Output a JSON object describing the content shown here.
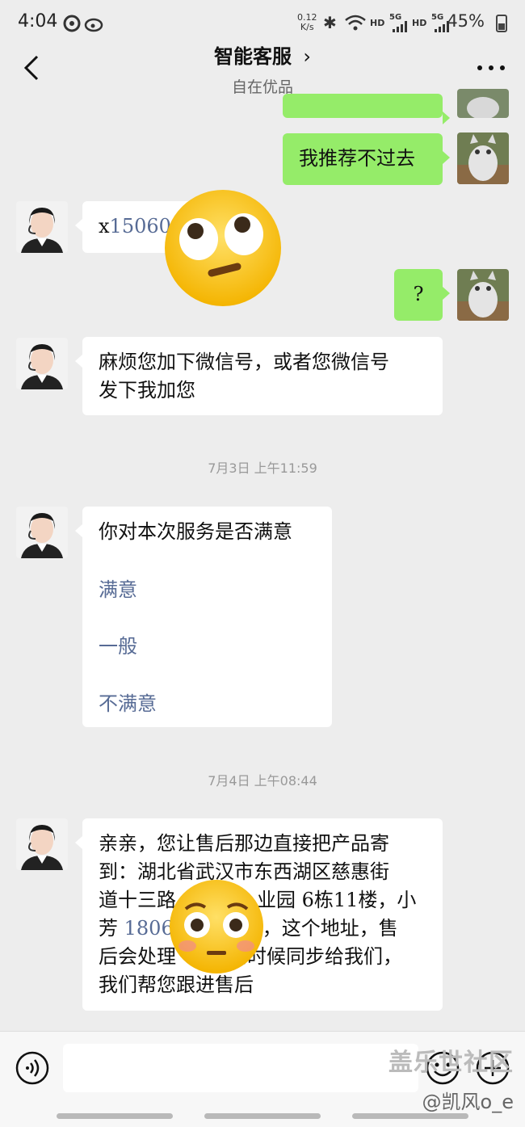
{
  "status": {
    "time": "4:04",
    "net_speed_top": "0.12",
    "net_speed_bottom": "K/s",
    "hd1": "HD",
    "sig1": "5G",
    "hd2": "HD",
    "sig2": "5G",
    "battery": "45%"
  },
  "nav": {
    "title": "智能客服",
    "subtitle": "自在优品"
  },
  "messages": {
    "m1": "我推荐不过去",
    "m2_prefix": "x",
    "m2_link": "15060",
    "m3": "?",
    "m4_line1": "麻烦您加下微信号，或者您微信号",
    "m4_line2": "发下我加您",
    "ts1": "7月3日 上午11:59",
    "m5_question": "你对本次服务是否满意",
    "m5_opt1": "满意",
    "m5_opt2": "一般",
    "m5_opt3": "不满意",
    "ts2": "7月4日 上午08:44",
    "m6_line1": "亲亲，您让售后那边直接把产品寄",
    "m6_line2": "到：湖北省武汉市东西湖区慈惠街",
    "m6_line3a": "道十三路",
    "m6_line3b": "业园 6栋11楼，小",
    "m6_line4a": "芳 ",
    "m6_line4link": "1806",
    "m6_line4b": "，这个地址，售",
    "m6_line5a": "后会处理",
    "m6_line5b": "到时候同步给我们，",
    "m6_line6": "我们帮您跟进售后"
  },
  "watermark": {
    "line1": "盖乐世社区",
    "line2": "@凯风o_e"
  },
  "colors": {
    "background": "#ededed",
    "outgoing_bubble": "#95ec69",
    "incoming_bubble": "#ffffff",
    "link": "#576b95"
  }
}
